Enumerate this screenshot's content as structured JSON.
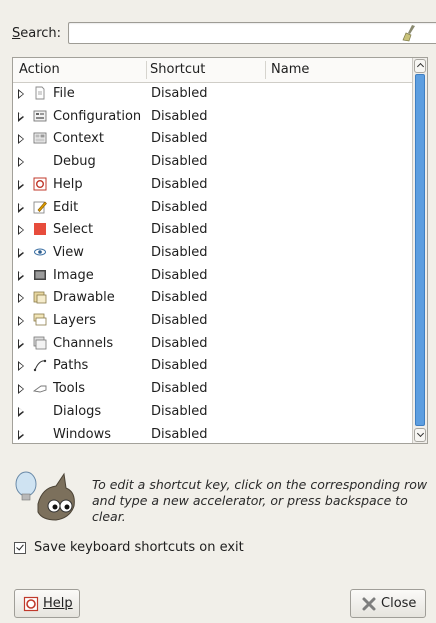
{
  "search": {
    "label": "Search:",
    "value": ""
  },
  "table": {
    "columns": {
      "action": "Action",
      "shortcut": "Shortcut",
      "name": "Name"
    },
    "rows": [
      {
        "label": "File",
        "shortcut": "Disabled",
        "icon": "file-icon"
      },
      {
        "label": "Configuration",
        "shortcut": "Disabled",
        "icon": "configuration-icon"
      },
      {
        "label": "Context",
        "shortcut": "Disabled",
        "icon": "context-icon"
      },
      {
        "label": "Debug",
        "shortcut": "Disabled",
        "icon": ""
      },
      {
        "label": "Help",
        "shortcut": "Disabled",
        "icon": "help-icon"
      },
      {
        "label": "Edit",
        "shortcut": "Disabled",
        "icon": "edit-icon"
      },
      {
        "label": "Select",
        "shortcut": "Disabled",
        "icon": "select-icon"
      },
      {
        "label": "View",
        "shortcut": "Disabled",
        "icon": "view-icon"
      },
      {
        "label": "Image",
        "shortcut": "Disabled",
        "icon": "image-icon"
      },
      {
        "label": "Drawable",
        "shortcut": "Disabled",
        "icon": "drawable-icon"
      },
      {
        "label": "Layers",
        "shortcut": "Disabled",
        "icon": "layers-icon"
      },
      {
        "label": "Channels",
        "shortcut": "Disabled",
        "icon": "channels-icon"
      },
      {
        "label": "Paths",
        "shortcut": "Disabled",
        "icon": "paths-icon"
      },
      {
        "label": "Tools",
        "shortcut": "Disabled",
        "icon": "tools-icon"
      },
      {
        "label": "Dialogs",
        "shortcut": "Disabled",
        "icon": ""
      },
      {
        "label": "Windows",
        "shortcut": "Disabled",
        "icon": ""
      }
    ]
  },
  "hint": "To edit a shortcut key, click on the corresponding row and type a new accelerator, or press backspace to clear.",
  "save_option": {
    "label": "Save keyboard shortcuts on exit",
    "checked": true
  },
  "buttons": {
    "help": "Help",
    "close": "Close"
  },
  "colors": {
    "scroll_thumb": "#5d9ee0",
    "background": "#f1efe9"
  }
}
